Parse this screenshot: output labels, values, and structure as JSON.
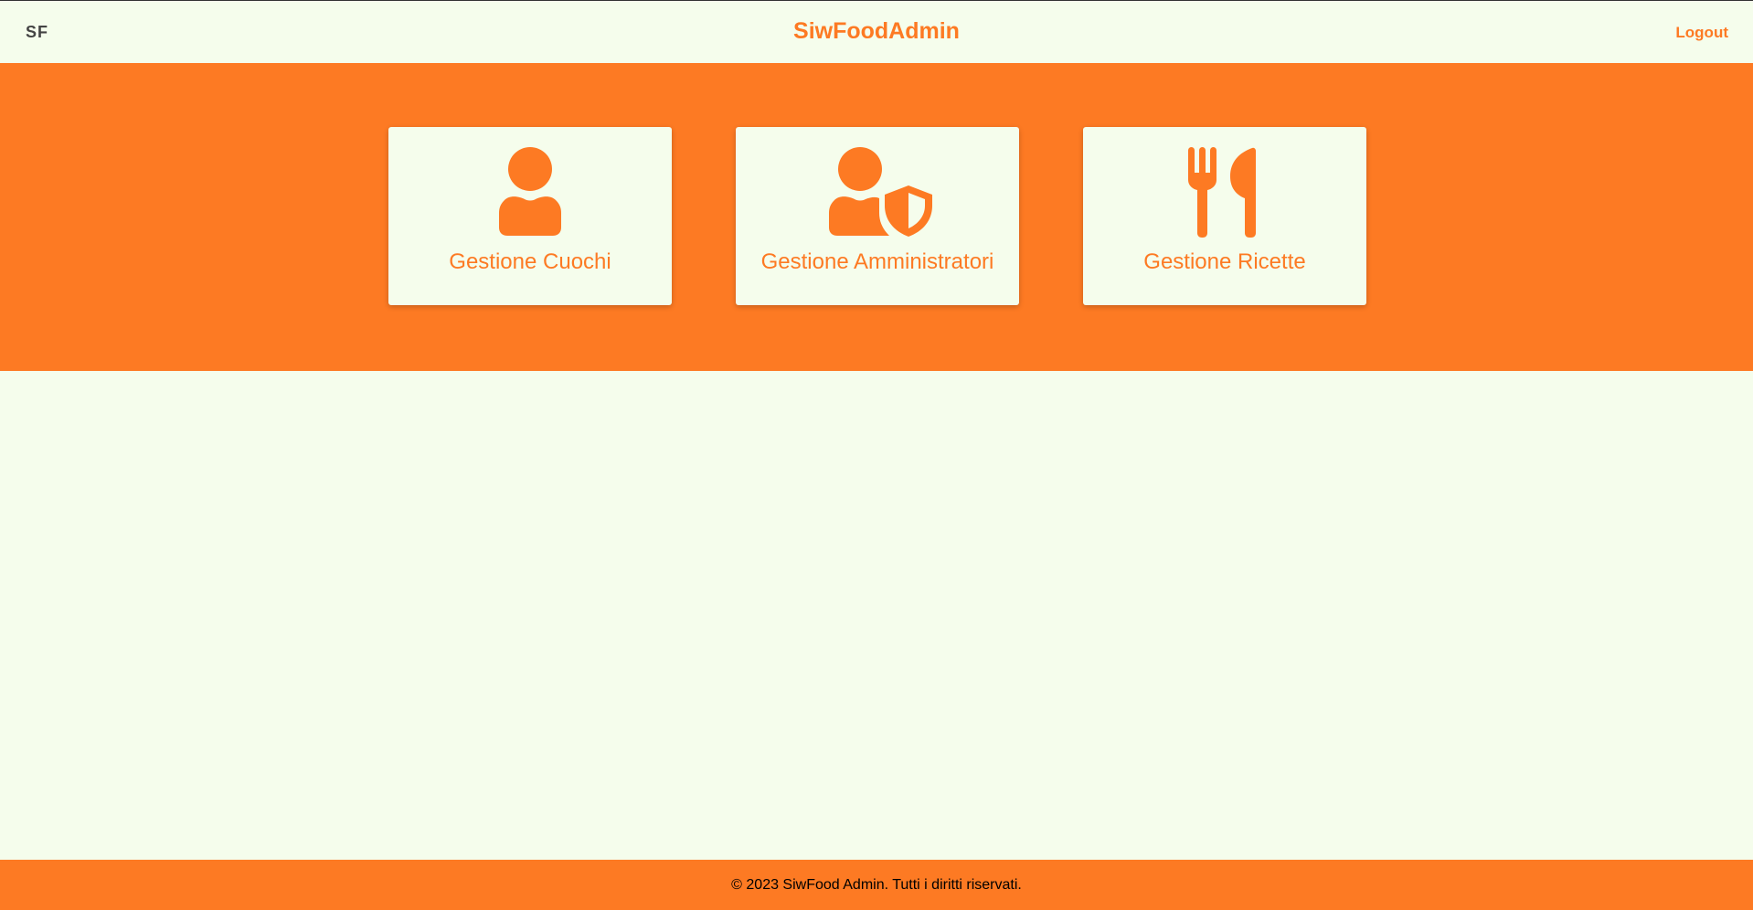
{
  "header": {
    "logo": "SF",
    "title": "SiwFoodAdmin",
    "logout_label": "Logout"
  },
  "cards": [
    {
      "label": "Gestione Cuochi",
      "icon": "user-icon"
    },
    {
      "label": "Gestione Amministratori",
      "icon": "user-shield-icon"
    },
    {
      "label": "Gestione Ricette",
      "icon": "utensils-icon"
    }
  ],
  "footer": {
    "copyright": "© 2023 SiwFood Admin. Tutti i diritti riservati."
  },
  "colors": {
    "accent": "#fd7a23",
    "background": "#f5fdec"
  }
}
